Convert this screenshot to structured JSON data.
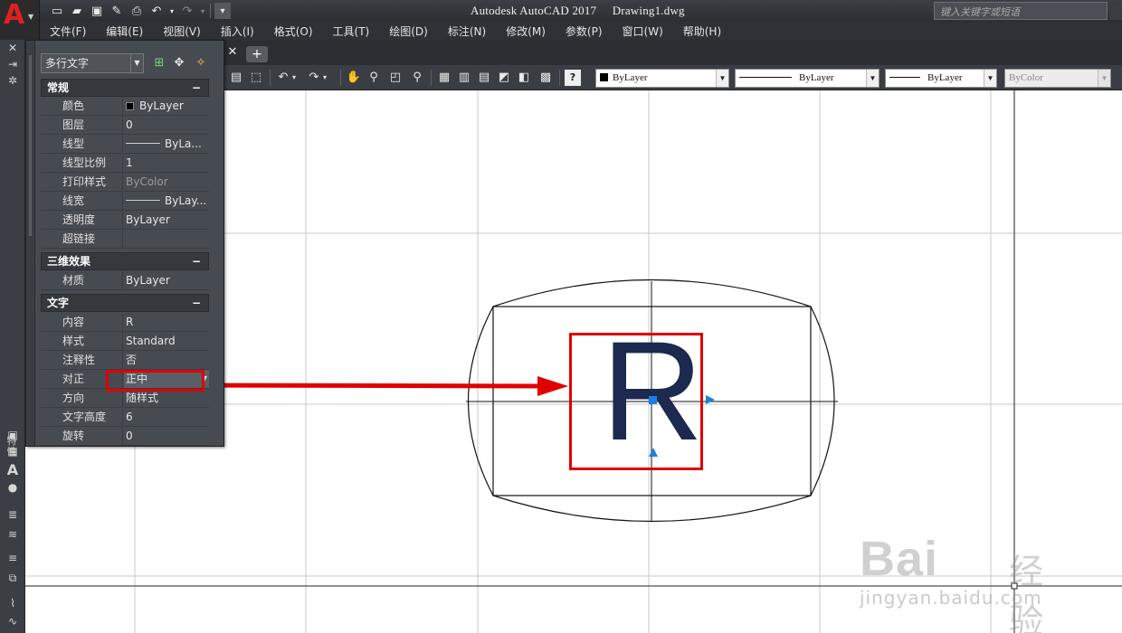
{
  "title": {
    "app": "Autodesk AutoCAD 2017",
    "file": "Drawing1.dwg"
  },
  "search": {
    "placeholder": "键入关键字或短语"
  },
  "menu": [
    "文件(F)",
    "编辑(E)",
    "视图(V)",
    "插入(I)",
    "格式(O)",
    "工具(T)",
    "绘图(D)",
    "标注(N)",
    "修改(M)",
    "参数(P)",
    "窗口(W)",
    "帮助(H)"
  ],
  "toolbar": {
    "color": "ByLayer",
    "linetype": "ByLayer",
    "lineweight": "ByLayer",
    "plotstyle": "ByColor"
  },
  "palette": {
    "object_type": "多行文字",
    "side_label": "特性",
    "sections": {
      "general": {
        "title": "常规",
        "rows": [
          {
            "label": "颜色",
            "value": "ByLayer"
          },
          {
            "label": "图层",
            "value": "0"
          },
          {
            "label": "线型",
            "value": "ByLa..."
          },
          {
            "label": "线型比例",
            "value": "1"
          },
          {
            "label": "打印样式",
            "value": "ByColor"
          },
          {
            "label": "线宽",
            "value": "ByLay..."
          },
          {
            "label": "透明度",
            "value": "ByLayer"
          },
          {
            "label": "超链接",
            "value": ""
          }
        ]
      },
      "three_d": {
        "title": "三维效果",
        "rows": [
          {
            "label": "材质",
            "value": "ByLayer"
          }
        ]
      },
      "text": {
        "title": "文字",
        "rows": [
          {
            "label": "内容",
            "value": "R"
          },
          {
            "label": "样式",
            "value": "Standard"
          },
          {
            "label": "注释性",
            "value": "否"
          },
          {
            "label": "对正",
            "value": "正中"
          },
          {
            "label": "方向",
            "value": "随样式"
          },
          {
            "label": "文字高度",
            "value": "6"
          },
          {
            "label": "旋转",
            "value": "0"
          }
        ]
      }
    }
  },
  "drawing": {
    "text": "R",
    "text_color": "#1b2a4e",
    "highlight_color": "#e00000",
    "grip_color": "#1e7fe0"
  },
  "watermark": {
    "brand": "Bai",
    "brand_cn": "经验",
    "url": "jingyan.baidu.com"
  }
}
